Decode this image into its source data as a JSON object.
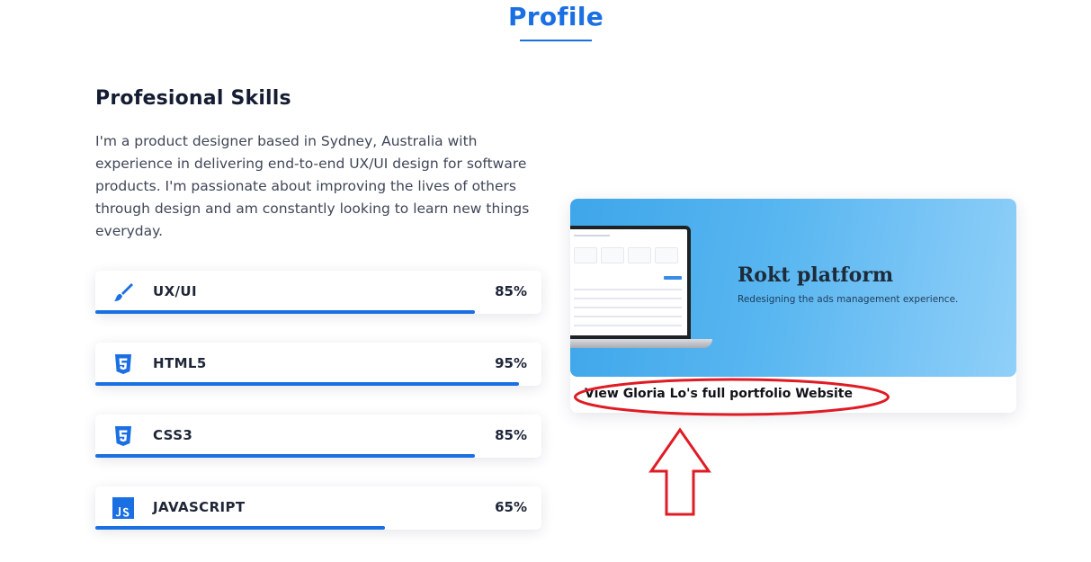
{
  "header": {
    "title": "Profile"
  },
  "skills_section": {
    "heading": "Profesional Skills",
    "bio": "I'm a product designer based in Sydney, Australia with experience in delivering end-to-end UX/UI design for software products. I'm passionate about improving the lives of others through design and am constantly looking to learn new things everyday.",
    "skills": [
      {
        "name": "UX/UI",
        "percent_label": "85%",
        "percent": 85,
        "icon": "brush-icon"
      },
      {
        "name": "HTML5",
        "percent_label": "95%",
        "percent": 95,
        "icon": "html5-icon"
      },
      {
        "name": "CSS3",
        "percent_label": "85%",
        "percent": 85,
        "icon": "css3-icon"
      },
      {
        "name": "JAVASCRIPT",
        "percent_label": "65%",
        "percent": 65,
        "icon": "javascript-icon"
      }
    ]
  },
  "portfolio": {
    "image_title": "Rokt platform",
    "image_subtitle": "Redesigning the ads management experience.",
    "link_text": "View Gloria Lo's full portfolio Website"
  },
  "annotation": {
    "color": "#e01b24",
    "shapes": [
      "ellipse-highlight",
      "up-arrow"
    ]
  },
  "colors": {
    "accent": "#1a6fe3",
    "heading": "#151d33",
    "annotation": "#e01b24"
  }
}
